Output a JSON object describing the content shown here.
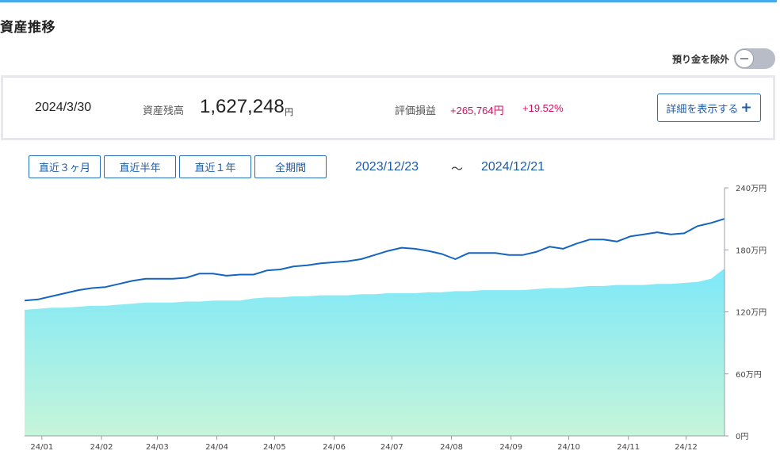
{
  "header": {
    "title": "資産推移"
  },
  "toggle": {
    "label": "預り金を除外",
    "on": false
  },
  "summary": {
    "date": "2024/3/30",
    "balance_label": "資産残高",
    "balance_value": "1,627,248",
    "balance_unit": "円",
    "pl_label": "評価損益",
    "pl_value": "+265,764円",
    "pl_percent": "+19.52%",
    "detail_button": "詳細を表示する",
    "detail_icon": "plus-icon"
  },
  "range_buttons": [
    "直近３ヶ月",
    "直近半年",
    "直近１年",
    "全期間"
  ],
  "date_range": {
    "from": "2023/12/23",
    "separator": "～",
    "to": "2024/12/21"
  },
  "colors": {
    "accent": "#1e5ba8",
    "line": "#1565c0",
    "area_top": "#7ee8f9",
    "area_bottom": "#c6f5d9",
    "positive": "#d0105e",
    "top_border": "#46a9ea"
  },
  "chart_data": {
    "type": "area",
    "x": [
      "2023/12/23",
      "2023/12/30",
      "2024/01/06",
      "2024/01/13",
      "2024/01/20",
      "2024/01/27",
      "2024/02/03",
      "2024/02/10",
      "2024/02/17",
      "2024/02/24",
      "2024/03/02",
      "2024/03/09",
      "2024/03/16",
      "2024/03/23",
      "2024/03/30",
      "2024/04/06",
      "2024/04/13",
      "2024/04/20",
      "2024/04/27",
      "2024/05/04",
      "2024/05/11",
      "2024/05/18",
      "2024/05/25",
      "2024/06/01",
      "2024/06/08",
      "2024/06/15",
      "2024/06/22",
      "2024/06/29",
      "2024/07/06",
      "2024/07/13",
      "2024/07/20",
      "2024/07/27",
      "2024/08/03",
      "2024/08/10",
      "2024/08/17",
      "2024/08/24",
      "2024/08/31",
      "2024/09/07",
      "2024/09/14",
      "2024/09/21",
      "2024/09/28",
      "2024/10/05",
      "2024/10/12",
      "2024/10/19",
      "2024/10/26",
      "2024/11/02",
      "2024/11/09",
      "2024/11/16",
      "2024/11/23",
      "2024/11/30",
      "2024/12/07",
      "2024/12/14",
      "2024/12/21"
    ],
    "series": [
      {
        "kind": "line",
        "values": [
          131,
          132,
          135,
          138,
          141,
          143,
          144,
          147,
          150,
          152,
          152,
          152,
          153,
          157,
          157,
          155,
          156,
          156,
          160,
          161,
          164,
          165,
          167,
          168,
          169,
          171,
          175,
          179,
          182,
          181,
          179,
          176,
          171,
          177,
          177,
          177,
          175,
          175,
          178,
          183,
          181,
          186,
          190,
          190,
          188,
          193,
          195,
          197,
          195,
          196,
          203,
          206,
          210
        ]
      },
      {
        "kind": "area",
        "values": [
          122,
          123,
          124,
          124,
          125,
          126,
          126,
          127,
          128,
          129,
          129,
          129,
          130,
          130,
          131,
          131,
          131,
          133,
          134,
          134,
          135,
          135,
          136,
          136,
          136,
          137,
          137,
          138,
          138,
          138,
          139,
          139,
          140,
          140,
          141,
          141,
          141,
          141,
          142,
          143,
          143,
          144,
          145,
          145,
          146,
          146,
          146,
          147,
          147,
          148,
          149,
          152,
          162
        ]
      }
    ],
    "xticks": [
      {
        "label": "24/01",
        "date": "2024/01/01"
      },
      {
        "label": "24/02",
        "date": "2024/02/01"
      },
      {
        "label": "24/03",
        "date": "2024/03/01"
      },
      {
        "label": "24/04",
        "date": "2024/04/01"
      },
      {
        "label": "24/05",
        "date": "2024/05/01"
      },
      {
        "label": "24/06",
        "date": "2024/06/01"
      },
      {
        "label": "24/07",
        "date": "2024/07/01"
      },
      {
        "label": "24/08",
        "date": "2024/08/01"
      },
      {
        "label": "24/09",
        "date": "2024/09/01"
      },
      {
        "label": "24/10",
        "date": "2024/10/01"
      },
      {
        "label": "24/11",
        "date": "2024/11/01"
      },
      {
        "label": "24/12",
        "date": "2024/12/01"
      }
    ],
    "yticks": [
      {
        "value": 0,
        "label": "0円"
      },
      {
        "value": 60,
        "label": "60万円"
      },
      {
        "value": 120,
        "label": "120万円"
      },
      {
        "value": 180,
        "label": "180万円"
      },
      {
        "value": 240,
        "label": "240万円"
      }
    ],
    "ylim": [
      0,
      240
    ],
    "yunit": "万円",
    "grid": false,
    "legend": "none"
  }
}
